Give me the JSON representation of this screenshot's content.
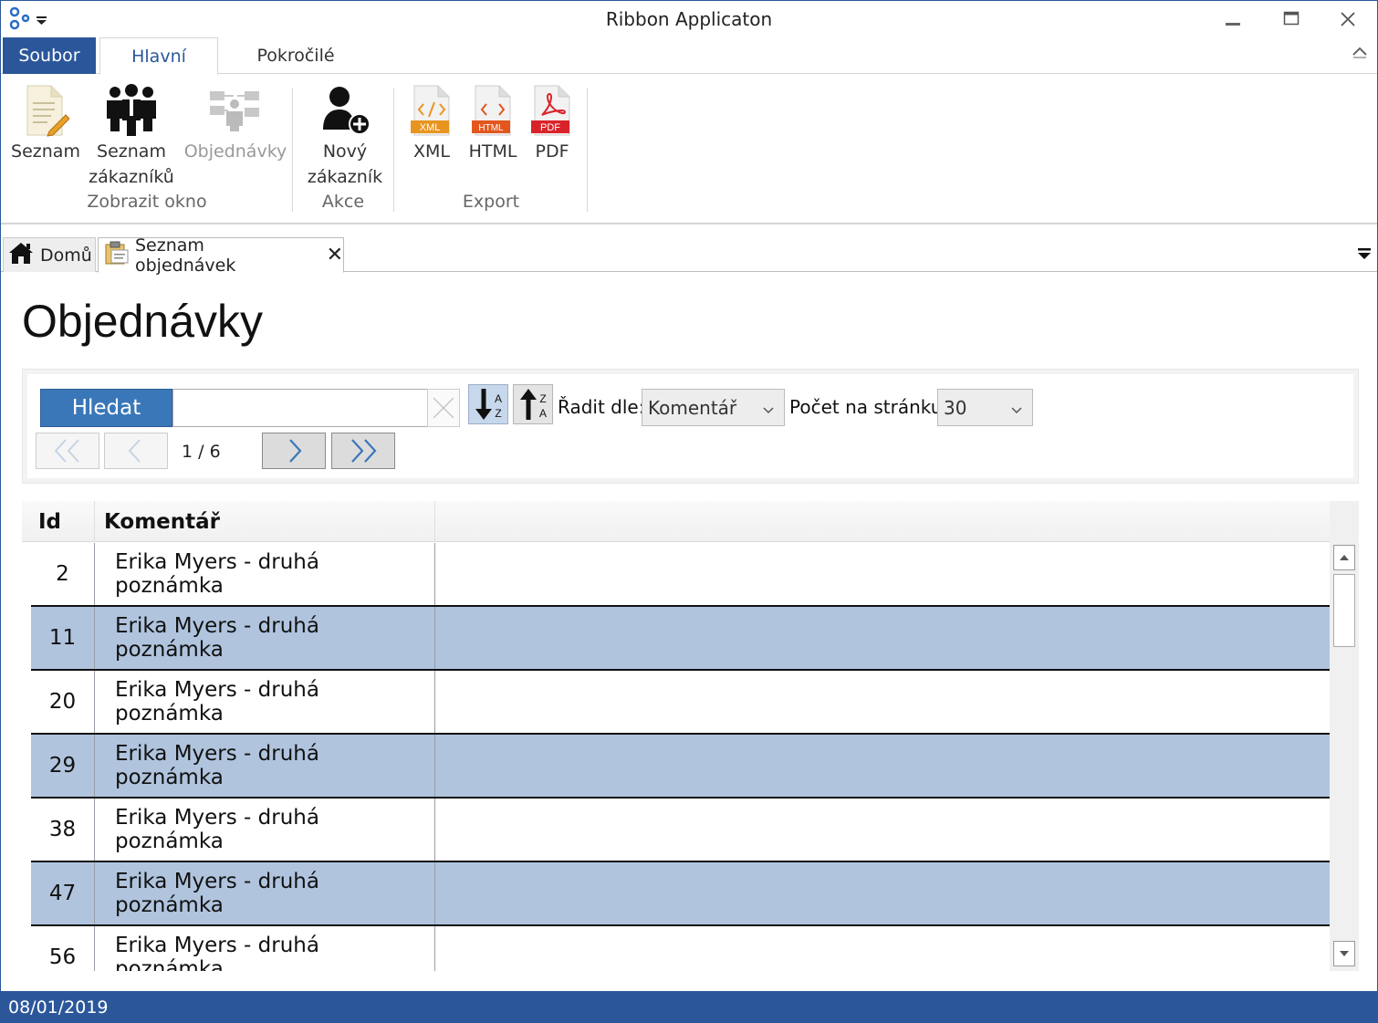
{
  "window": {
    "title": "Ribbon Applicaton"
  },
  "ribbon": {
    "tabs": {
      "file": "Soubor",
      "main": "Hlavní",
      "advanced": "Pokročilé"
    },
    "groups": {
      "view": {
        "label": "Zobrazit okno",
        "buttons": {
          "list": "Seznam",
          "customers_line1": "Seznam",
          "customers_line2": "zákazníků",
          "orders": "Objednávky"
        }
      },
      "actions": {
        "label": "Akce",
        "buttons": {
          "new_customer_line1": "Nový",
          "new_customer_line2": "zákazník"
        }
      },
      "export": {
        "label": "Export",
        "buttons": {
          "xml": "XML",
          "html": "HTML",
          "pdf": "PDF"
        },
        "badges": {
          "xml": "XML",
          "html": "HTML",
          "pdf": "PDF"
        }
      }
    }
  },
  "doc_tabs": {
    "home": "Domů",
    "orders": "Seznam objednávek"
  },
  "page": {
    "title": "Objednávky"
  },
  "toolbar": {
    "search_label": "Hledat",
    "search_value": "",
    "sort_label": "Řadit dle:",
    "sort_value": "Komentář",
    "per_page_label": "Počet na stránku:",
    "per_page_value": "30",
    "page_indicator": "1 / 6"
  },
  "grid": {
    "columns": {
      "id": "Id",
      "comment": "Komentář"
    },
    "rows": [
      {
        "id": "2",
        "comment": "Erika Myers - druhá poznámka"
      },
      {
        "id": "11",
        "comment": "Erika Myers - druhá poznámka"
      },
      {
        "id": "20",
        "comment": "Erika Myers - druhá poznámka"
      },
      {
        "id": "29",
        "comment": "Erika Myers - druhá poznámka"
      },
      {
        "id": "38",
        "comment": "Erika Myers - druhá poznámka"
      },
      {
        "id": "47",
        "comment": "Erika Myers - druhá poznámka"
      },
      {
        "id": "56",
        "comment": "Erika Myers - druhá poznámka"
      }
    ]
  },
  "statusbar": {
    "date": "08/01/2019"
  },
  "colors": {
    "accent": "#2b579a",
    "search_button": "#3a77b8",
    "alt_row": "#b0c4de"
  }
}
